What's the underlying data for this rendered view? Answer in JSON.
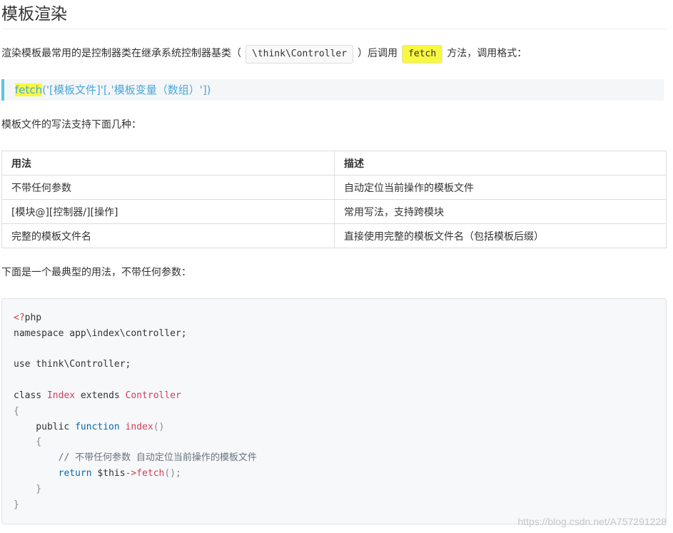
{
  "title": "模板渲染",
  "intro": {
    "text1": "渲染模板最常用的是控制器类在继承系统控制器基类（",
    "code1": "\\think\\Controller",
    "text2": "）后调用",
    "code2": "fetch",
    "text3": "方法，调用格式："
  },
  "quote": {
    "fn": "fetch",
    "rest": "('[模板文件]'[,'模板变量（数组）'])"
  },
  "para1": "模板文件的写法支持下面几种：",
  "table": {
    "headers": [
      "用法",
      "描述"
    ],
    "rows": [
      [
        "不带任何参数",
        "自动定位当前操作的模板文件"
      ],
      [
        "[模块@][控制器/][操作]",
        "常用写法，支持跨模块"
      ],
      [
        "完整的模板文件名",
        "直接使用完整的模板文件名（包括模板后缀）"
      ]
    ]
  },
  "para2": "下面是一个最典型的用法，不带任何参数：",
  "code": {
    "l1_a": "<?",
    "l1_b": "php",
    "l2": "namespace app\\index\\controller;",
    "l4": "use think\\Controller;",
    "l6_a": "class ",
    "l6_b": "Index",
    "l6_c": " extends ",
    "l6_d": "Controller",
    "l7": "{",
    "l8_a": "    public ",
    "l8_b": "function",
    "l8_c": " ",
    "l8_d": "index",
    "l8_e": "()",
    "l9": "    {",
    "l10": "        // 不带任何参数 自动定位当前操作的模板文件",
    "l11_a": "        ",
    "l11_b": "return",
    "l11_c": " $this",
    "l11_d": "->",
    "l11_e": "fetch",
    "l11_f": "();",
    "l12": "    }",
    "l13": "}"
  },
  "watermark": "https://blog.csdn.net/A757291228"
}
